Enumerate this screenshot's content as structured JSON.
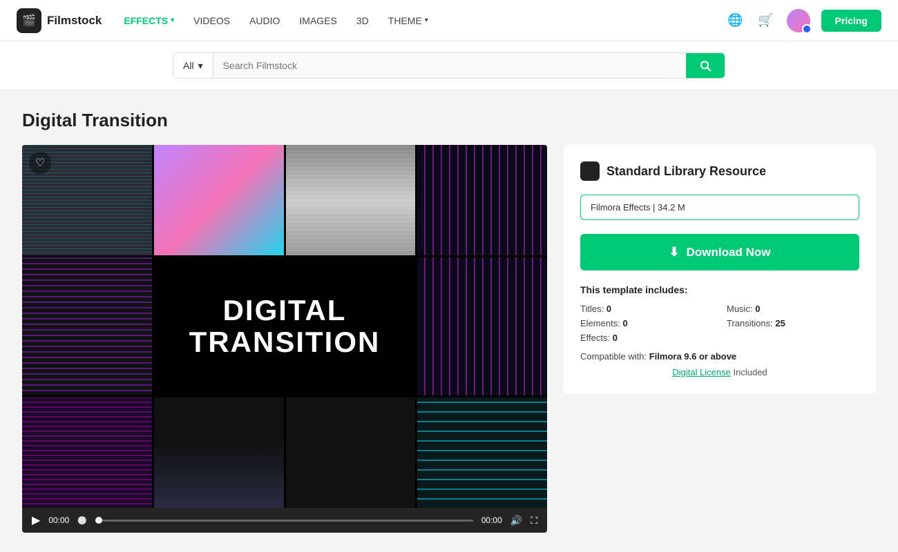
{
  "header": {
    "logo_text": "Filmstock",
    "logo_icon": "🎬",
    "nav": [
      {
        "label": "EFFECTS",
        "active": true,
        "has_chevron": true
      },
      {
        "label": "VIDEOS",
        "active": false,
        "has_chevron": false
      },
      {
        "label": "AUDIO",
        "active": false,
        "has_chevron": false
      },
      {
        "label": "IMAGES",
        "active": false,
        "has_chevron": false
      },
      {
        "label": "3D",
        "active": false,
        "has_chevron": false
      },
      {
        "label": "THEME",
        "active": false,
        "has_chevron": true
      }
    ],
    "pricing_label": "Pricing"
  },
  "search": {
    "category": "All",
    "placeholder": "Search Filmstock"
  },
  "page": {
    "title": "Digital Transition"
  },
  "video": {
    "main_text_line1": "DIGITAL",
    "main_text_line2": "TRANSITION",
    "time_current": "00:00",
    "time_total": "00:00"
  },
  "right_panel": {
    "resource_label": "Standard Library Resource",
    "file_info": "Filmora Effects | 34.2 M",
    "download_label": "Download Now",
    "template_includes_label": "This template includes:",
    "titles_label": "Titles:",
    "titles_val": "0",
    "music_label": "Music:",
    "music_val": "0",
    "elements_label": "Elements:",
    "elements_val": "0",
    "transitions_label": "Transitions:",
    "transitions_val": "25",
    "effects_label": "Effects:",
    "effects_val": "0",
    "compatible_label": "Compatible with:",
    "compatible_val": "Filmora 9.6 or above",
    "license_link_text": "Digital License",
    "license_included": "Included"
  }
}
